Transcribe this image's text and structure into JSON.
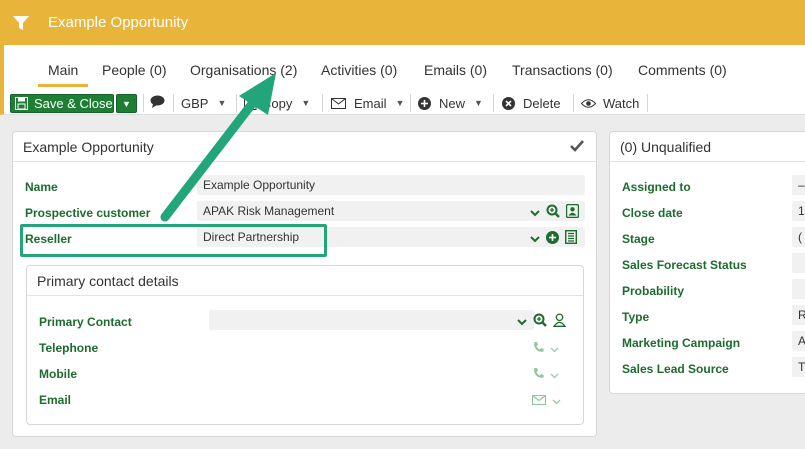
{
  "window": {
    "title": "Example Opportunity"
  },
  "tabs": [
    {
      "label": "Main"
    },
    {
      "label": "People (0)"
    },
    {
      "label": "Organisations (2)"
    },
    {
      "label": "Activities (0)"
    },
    {
      "label": "Emails (0)"
    },
    {
      "label": "Transactions (0)"
    },
    {
      "label": "Comments (0)"
    }
  ],
  "toolbar": {
    "save_close": "Save & Close",
    "currency": "GBP",
    "copy": "Copy",
    "email": "Email",
    "new": "New",
    "delete": "Delete",
    "watch": "Watch"
  },
  "main_card": {
    "title": "Example Opportunity",
    "name_label": "Name",
    "name_value": "Example Opportunity",
    "prospective_label": "Prospective customer",
    "prospective_value": "APAK Risk Management",
    "reseller_label": "Reseller",
    "reseller_value": "Direct Partnership"
  },
  "contact_card": {
    "title": "Primary contact details",
    "primary_contact_label": "Primary Contact",
    "primary_contact_value": "",
    "telephone_label": "Telephone",
    "mobile_label": "Mobile",
    "email_label": "Email"
  },
  "status_card": {
    "title": "(0) Unqualified",
    "fields": [
      {
        "label": "Assigned to",
        "value": "–"
      },
      {
        "label": "Close date",
        "value": "1"
      },
      {
        "label": "Stage",
        "value": "("
      },
      {
        "label": "Sales Forecast Status",
        "value": ""
      },
      {
        "label": "Probability",
        "value": ""
      },
      {
        "label": "Type",
        "value": "R"
      },
      {
        "label": "Marketing Campaign",
        "value": "A"
      },
      {
        "label": "Sales Lead Source",
        "value": "T"
      }
    ]
  },
  "colors": {
    "brand": "#e8b53a",
    "label_green": "#1e6b2e",
    "save_green": "#1e7e34",
    "annotation": "#22a57a"
  }
}
